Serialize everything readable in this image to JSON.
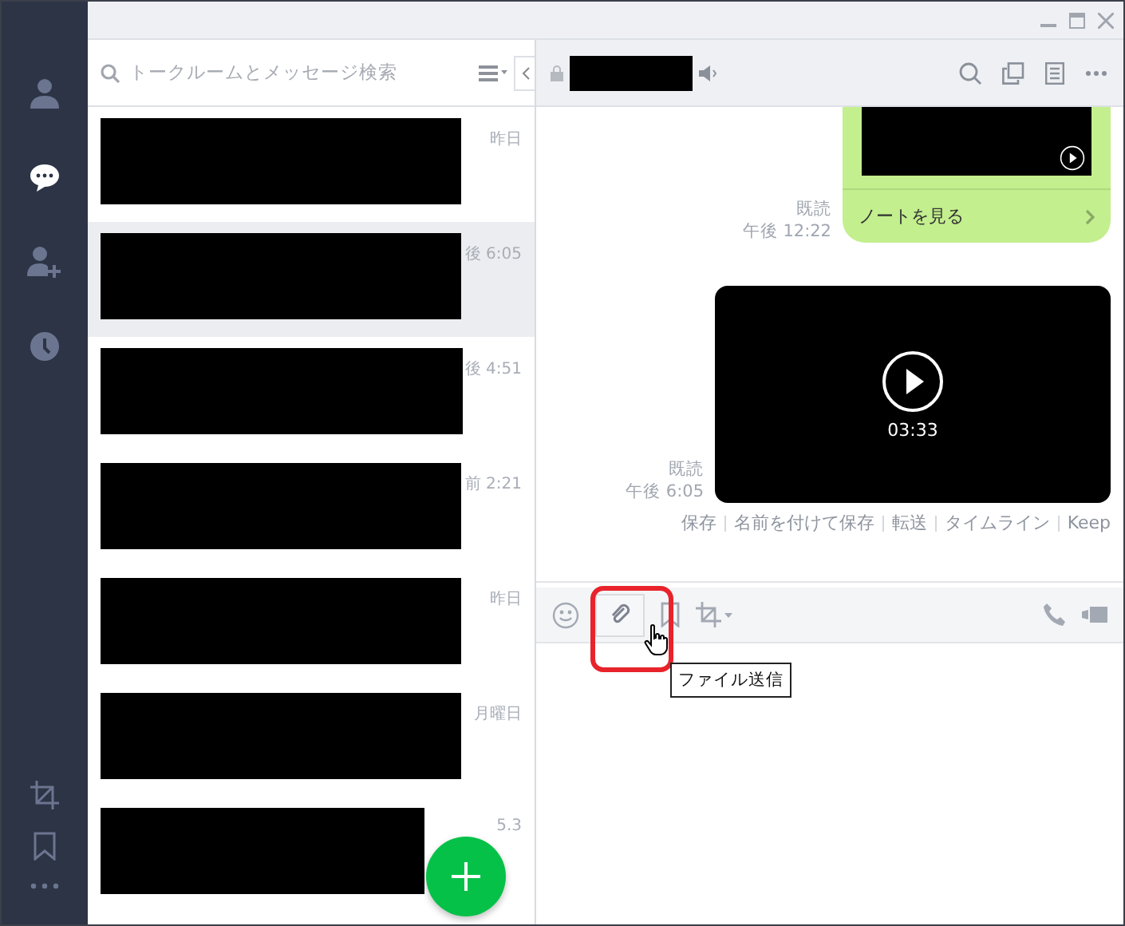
{
  "search": {
    "placeholder": "トークルームとメッセージ検索"
  },
  "sidebar": {
    "items": [
      {
        "kind": "friends",
        "selected": false
      },
      {
        "kind": "chats",
        "selected": true
      },
      {
        "kind": "add-friend",
        "selected": false
      },
      {
        "kind": "timeline",
        "selected": false
      }
    ]
  },
  "chats": [
    {
      "time": "昨日",
      "selected": false
    },
    {
      "time": "後 6:05",
      "selected": true
    },
    {
      "time": "後 4:51",
      "selected": false
    },
    {
      "time": "前 2:21",
      "selected": false
    },
    {
      "time": "昨日",
      "selected": false
    },
    {
      "time": "月曜日",
      "selected": false
    },
    {
      "time": "5.3",
      "selected": false
    }
  ],
  "messages": [
    {
      "kind": "note",
      "read": "既読",
      "time": "午後 12:22",
      "link": "ノートを見る"
    },
    {
      "kind": "video",
      "read": "既読",
      "time": "午後 6:05",
      "duration": "03:33"
    }
  ],
  "media_actions": [
    "保存",
    "名前を付けて保存",
    "転送",
    "タイムライン",
    "Keep"
  ],
  "tooltip": "ファイル送信"
}
